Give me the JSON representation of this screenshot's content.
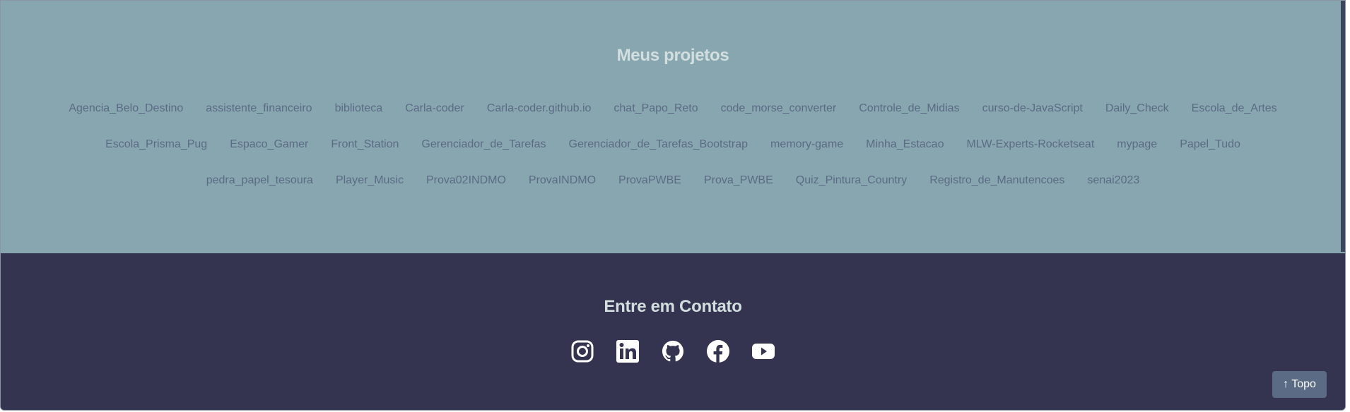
{
  "projects": {
    "title": "Meus projetos",
    "items": [
      "Agencia_Belo_Destino",
      "assistente_financeiro",
      "biblioteca",
      "Carla-coder",
      "Carla-coder.github.io",
      "chat_Papo_Reto",
      "code_morse_converter",
      "Controle_de_Midias",
      "curso-de-JavaScript",
      "Daily_Check",
      "Escola_de_Artes",
      "Escola_Prisma_Pug",
      "Espaco_Gamer",
      "Front_Station",
      "Gerenciador_de_Tarefas",
      "Gerenciador_de_Tarefas_Bootstrap",
      "memory-game",
      "Minha_Estacao",
      "MLW-Experts-Rocketseat",
      "mypage",
      "Papel_Tudo",
      "pedra_papel_tesoura",
      "Player_Music",
      "Prova02INDMO",
      "ProvaINDMO",
      "ProvaPWBE",
      "Prova_PWBE",
      "Quiz_Pintura_Country",
      "Registro_de_Manutencoes",
      "senai2023"
    ]
  },
  "contact": {
    "title": "Entre em Contato",
    "social": [
      {
        "icon": "instagram-icon"
      },
      {
        "icon": "linkedin-icon"
      },
      {
        "icon": "github-icon"
      },
      {
        "icon": "facebook-icon"
      },
      {
        "icon": "youtube-icon"
      }
    ]
  },
  "top_button": {
    "label": "↑ Topo"
  },
  "colors": {
    "projects_bg": "#88a6af",
    "contact_bg": "#343450",
    "heading": "#d3dfdf",
    "link": "#5b6b86",
    "button_bg": "#5b6b86"
  }
}
